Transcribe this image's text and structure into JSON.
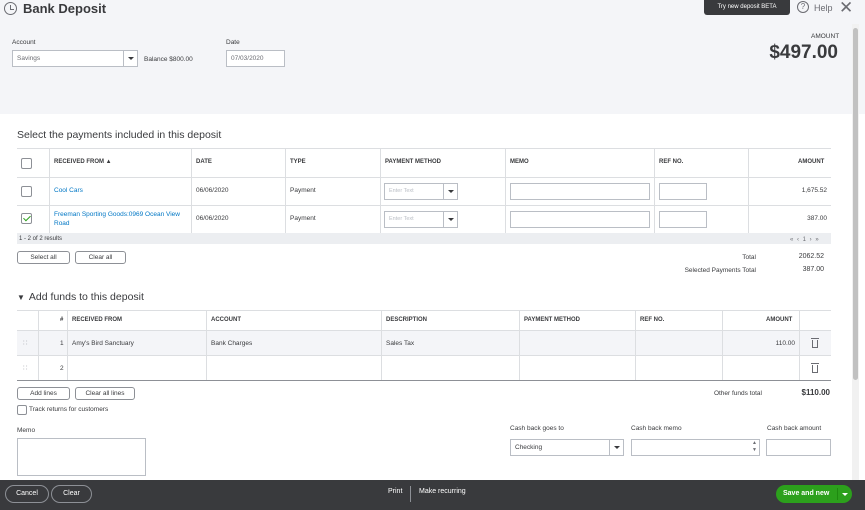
{
  "header": {
    "title": "Bank Deposit",
    "try_new": "Try new deposit BETA",
    "help": "Help",
    "close": "✕",
    "help_glyph": "?",
    "account_label": "Account",
    "account_value": "Savings",
    "balance_label": "Balance $800.00",
    "date_label": "Date",
    "date_value": "07/03/2020",
    "amount_label": "AMOUNT",
    "amount_value": "$497.00"
  },
  "payments": {
    "section_title": "Select the payments included in this deposit",
    "columns": [
      "RECEIVED FROM ▲",
      "DATE",
      "TYPE",
      "PAYMENT METHOD",
      "MEMO",
      "REF NO.",
      "AMOUNT"
    ],
    "rows": [
      {
        "checked": false,
        "received_from": "Cool Cars",
        "date": "06/06/2020",
        "type": "Payment",
        "method_placeholder": "Enter Text",
        "amount": "1,675.52"
      },
      {
        "checked": true,
        "received_from": "Freeman Sporting Goods:0969 Ocean View Road",
        "date": "06/06/2020",
        "type": "Payment",
        "method_placeholder": "Enter Text",
        "amount": "387.00"
      }
    ],
    "results": "1 - 2 of 2 results",
    "pager": "« ‹ 1 › »",
    "select_all": "Select all",
    "clear_all": "Clear all",
    "total_label": "Total",
    "total_value": "2062.52",
    "selected_label": "Selected Payments Total",
    "selected_value": "387.00"
  },
  "funds": {
    "section_title": "Add funds to this deposit",
    "toggle": "▼",
    "columns": [
      "#",
      "RECEIVED FROM",
      "ACCOUNT",
      "DESCRIPTION",
      "PAYMENT METHOD",
      "REF NO.",
      "AMOUNT"
    ],
    "rows": [
      {
        "num": "1",
        "received_from": "Amy's Bird Sanctuary",
        "account": "Bank Charges",
        "description": "Sales Tax",
        "amount": "110.00"
      },
      {
        "num": "2",
        "received_from": "",
        "account": "",
        "description": "",
        "amount": ""
      }
    ],
    "grip": "∷",
    "add_lines": "Add lines",
    "clear_all_lines": "Clear all lines",
    "other_total_label": "Other funds total",
    "other_total_value": "$110.00",
    "track_returns": "Track returns for customers"
  },
  "memo": {
    "label": "Memo"
  },
  "cashback": {
    "goes_to_label": "Cash back goes to",
    "goes_to_value": "Checking",
    "memo_label": "Cash back memo",
    "amount_label": "Cash back amount"
  },
  "footer": {
    "cancel": "Cancel",
    "clear": "Clear",
    "print": "Print",
    "make_recurring": "Make recurring",
    "save": "Save and new"
  }
}
